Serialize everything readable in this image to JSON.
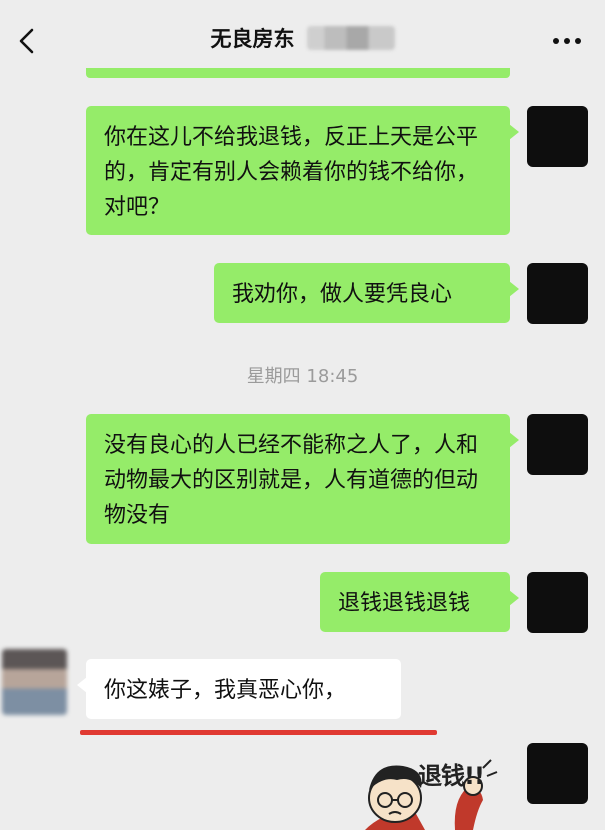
{
  "header": {
    "title": "无良房东",
    "back_icon": "chevron-left-icon",
    "more_icon": "more-horizontal-icon"
  },
  "messages": [
    {
      "side": "right",
      "text": "你在这儿不给我退钱，反正上天是公平的，肯定有别人会赖着你的钱不给你，对吧？"
    },
    {
      "side": "right",
      "text": "我劝你，做人要凭良心"
    },
    {
      "side": "right",
      "text": "没有良心的人已经不能称之人了，人和动物最大的区别就是，人有道德的但动物没有"
    },
    {
      "side": "right",
      "text": "退钱退钱退钱"
    },
    {
      "side": "left",
      "text": "你这婊子，我真恶心你，"
    }
  ],
  "timestamp": "星期四 18:45",
  "sticker": {
    "text": "退钱!!"
  },
  "colors": {
    "background": "#ededed",
    "own_bubble": "#95ec69",
    "other_bubble": "#ffffff",
    "underline": "#e03a32"
  }
}
